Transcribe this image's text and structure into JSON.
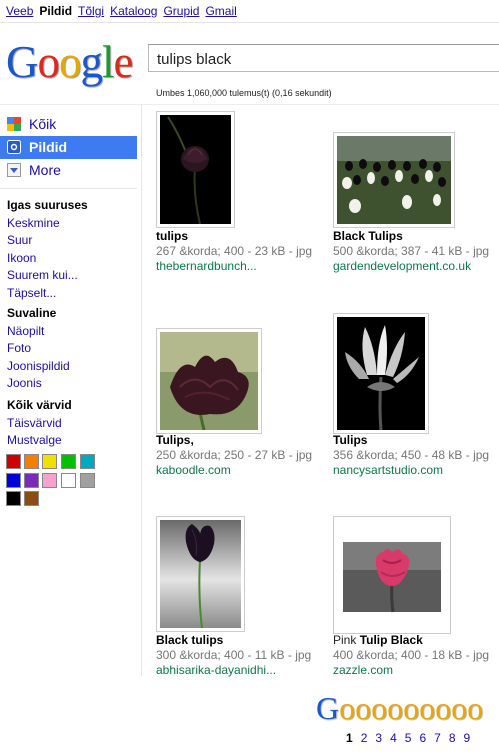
{
  "topbar": {
    "links": [
      "Veeb",
      "Pildid",
      "Tõlgi",
      "Kataloog",
      "Grupid",
      "Gmail"
    ],
    "current": "Pildid"
  },
  "logo": {
    "text": "Google"
  },
  "search": {
    "value": "tulips black"
  },
  "stats": "Umbes 1,060,000 tulemus(t) (0,16 sekundit)",
  "modes": [
    {
      "label": "Kõik",
      "icon": "all-results-icon"
    },
    {
      "label": "Pildid",
      "icon": "images-icon"
    },
    {
      "label": "More",
      "icon": "chevron-down-icon"
    }
  ],
  "filters": {
    "size": {
      "heading": "Igas suuruses",
      "items": [
        "Keskmine",
        "Suur",
        "Ikoon",
        "Suurem kui...",
        "Täpselt..."
      ]
    },
    "type": {
      "heading": "Suvaline",
      "items": [
        "Näopilt",
        "Foto",
        "Joonispildid",
        "Joonis"
      ]
    },
    "color": {
      "heading": "Kõik värvid",
      "items": [
        "Täisvärvid",
        "Mustvalge"
      ]
    }
  },
  "colors": [
    "#d00000",
    "#f08000",
    "#f0e000",
    "#00c000",
    "#00a8c0",
    "#0000d8",
    "#7c2ab8",
    "#f8a0d0",
    "#ffffff",
    "#a0a0a0",
    "#000000",
    "#8a4d14"
  ],
  "results": [
    {
      "title_prefix": "",
      "title": "tulips",
      "meta": "267 &korda; 400 - 23 kB - jpg",
      "src": "thebernardbunch..."
    },
    {
      "title_prefix": "",
      "title": "Black Tulips",
      "meta": "500 &korda; 387 - 41 kB - jpg",
      "src": "gardendevelopment.co.uk"
    },
    {
      "title_prefix": "",
      "title": "Tulips,",
      "meta": "250 &korda; 250 - 27 kB - jpg",
      "src": "kaboodle.com"
    },
    {
      "title_prefix": "",
      "title": "Tulips",
      "meta": "356 &korda; 450 - 48 kB - jpg",
      "src": "nancysartstudio.com"
    },
    {
      "title_prefix": "",
      "title": "Black tulips",
      "meta": "300 &korda; 400 - 11 kB - jpg",
      "src": "abhisarika-dayanidhi..."
    },
    {
      "title_prefix": "Pink ",
      "title": "Tulip Black",
      "meta": "400 &korda; 400 - 18 kB - jpg",
      "src": "zazzle.com"
    }
  ],
  "pager": {
    "logo": "Gooooooooo",
    "pages": [
      "1",
      "2",
      "3",
      "4",
      "5",
      "6",
      "7",
      "8",
      "9"
    ],
    "current": "1"
  }
}
